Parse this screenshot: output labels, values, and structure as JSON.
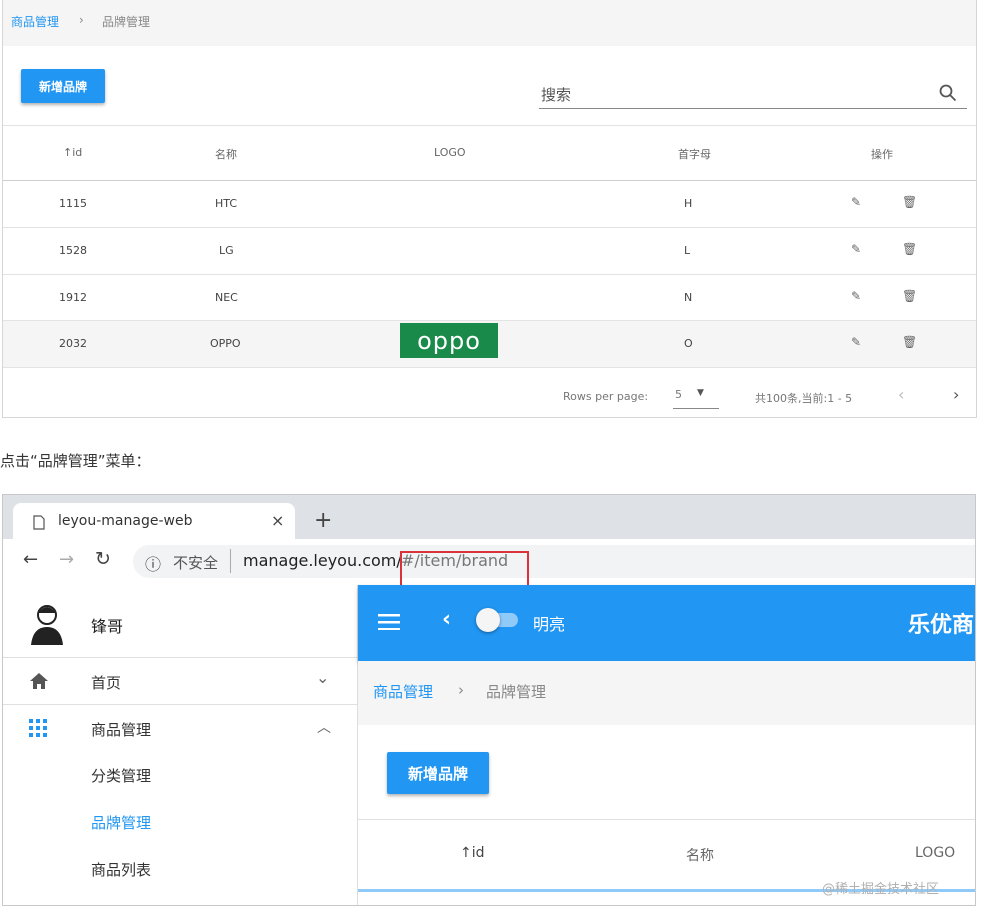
{
  "top": {
    "breadcrumb": {
      "parent": "商品管理",
      "sep": "›",
      "current": "品牌管理"
    },
    "add_button": "新增品牌",
    "search": {
      "placeholder": "搜索"
    },
    "columns": [
      "↑id",
      "名称",
      "LOGO",
      "首字母",
      "操作"
    ],
    "rows": [
      {
        "id": "1115",
        "name": "HTC",
        "logo": "",
        "letter": "H"
      },
      {
        "id": "1528",
        "name": "LG",
        "logo": "",
        "letter": "L"
      },
      {
        "id": "1912",
        "name": "NEC",
        "logo": "",
        "letter": "N"
      },
      {
        "id": "2032",
        "name": "OPPO",
        "logo": "oppo",
        "letter": "O"
      }
    ],
    "footer": {
      "rows_per_page_label": "Rows per page:",
      "rows_per_page_value": "5",
      "range": "共100条,当前:1 - 5"
    }
  },
  "caption": "点击“品牌管理”菜单：",
  "browser": {
    "tab_title": "leyou-manage-web",
    "security_label": "不安全",
    "url_host": "manage.leyou.com/",
    "url_path": "#/item/brand"
  },
  "sidebar": {
    "user": "锋哥",
    "items": [
      {
        "label": "首页"
      },
      {
        "label": "商品管理"
      },
      {
        "label": "分类管理"
      },
      {
        "label": "品牌管理"
      },
      {
        "label": "商品列表"
      }
    ]
  },
  "appbar": {
    "toggle_label": "明亮",
    "title": "乐优商"
  },
  "content": {
    "breadcrumb": {
      "parent": "商品管理",
      "sep": "›",
      "current": "品牌管理"
    },
    "add_button": "新增品牌",
    "columns": [
      "↑id",
      "名称",
      "LOGO"
    ]
  },
  "watermark": "@稀土掘金技术社区",
  "colors": {
    "primary": "#2196f3",
    "oppo_green": "#1a8a4a",
    "highlight": "#d9323a"
  }
}
